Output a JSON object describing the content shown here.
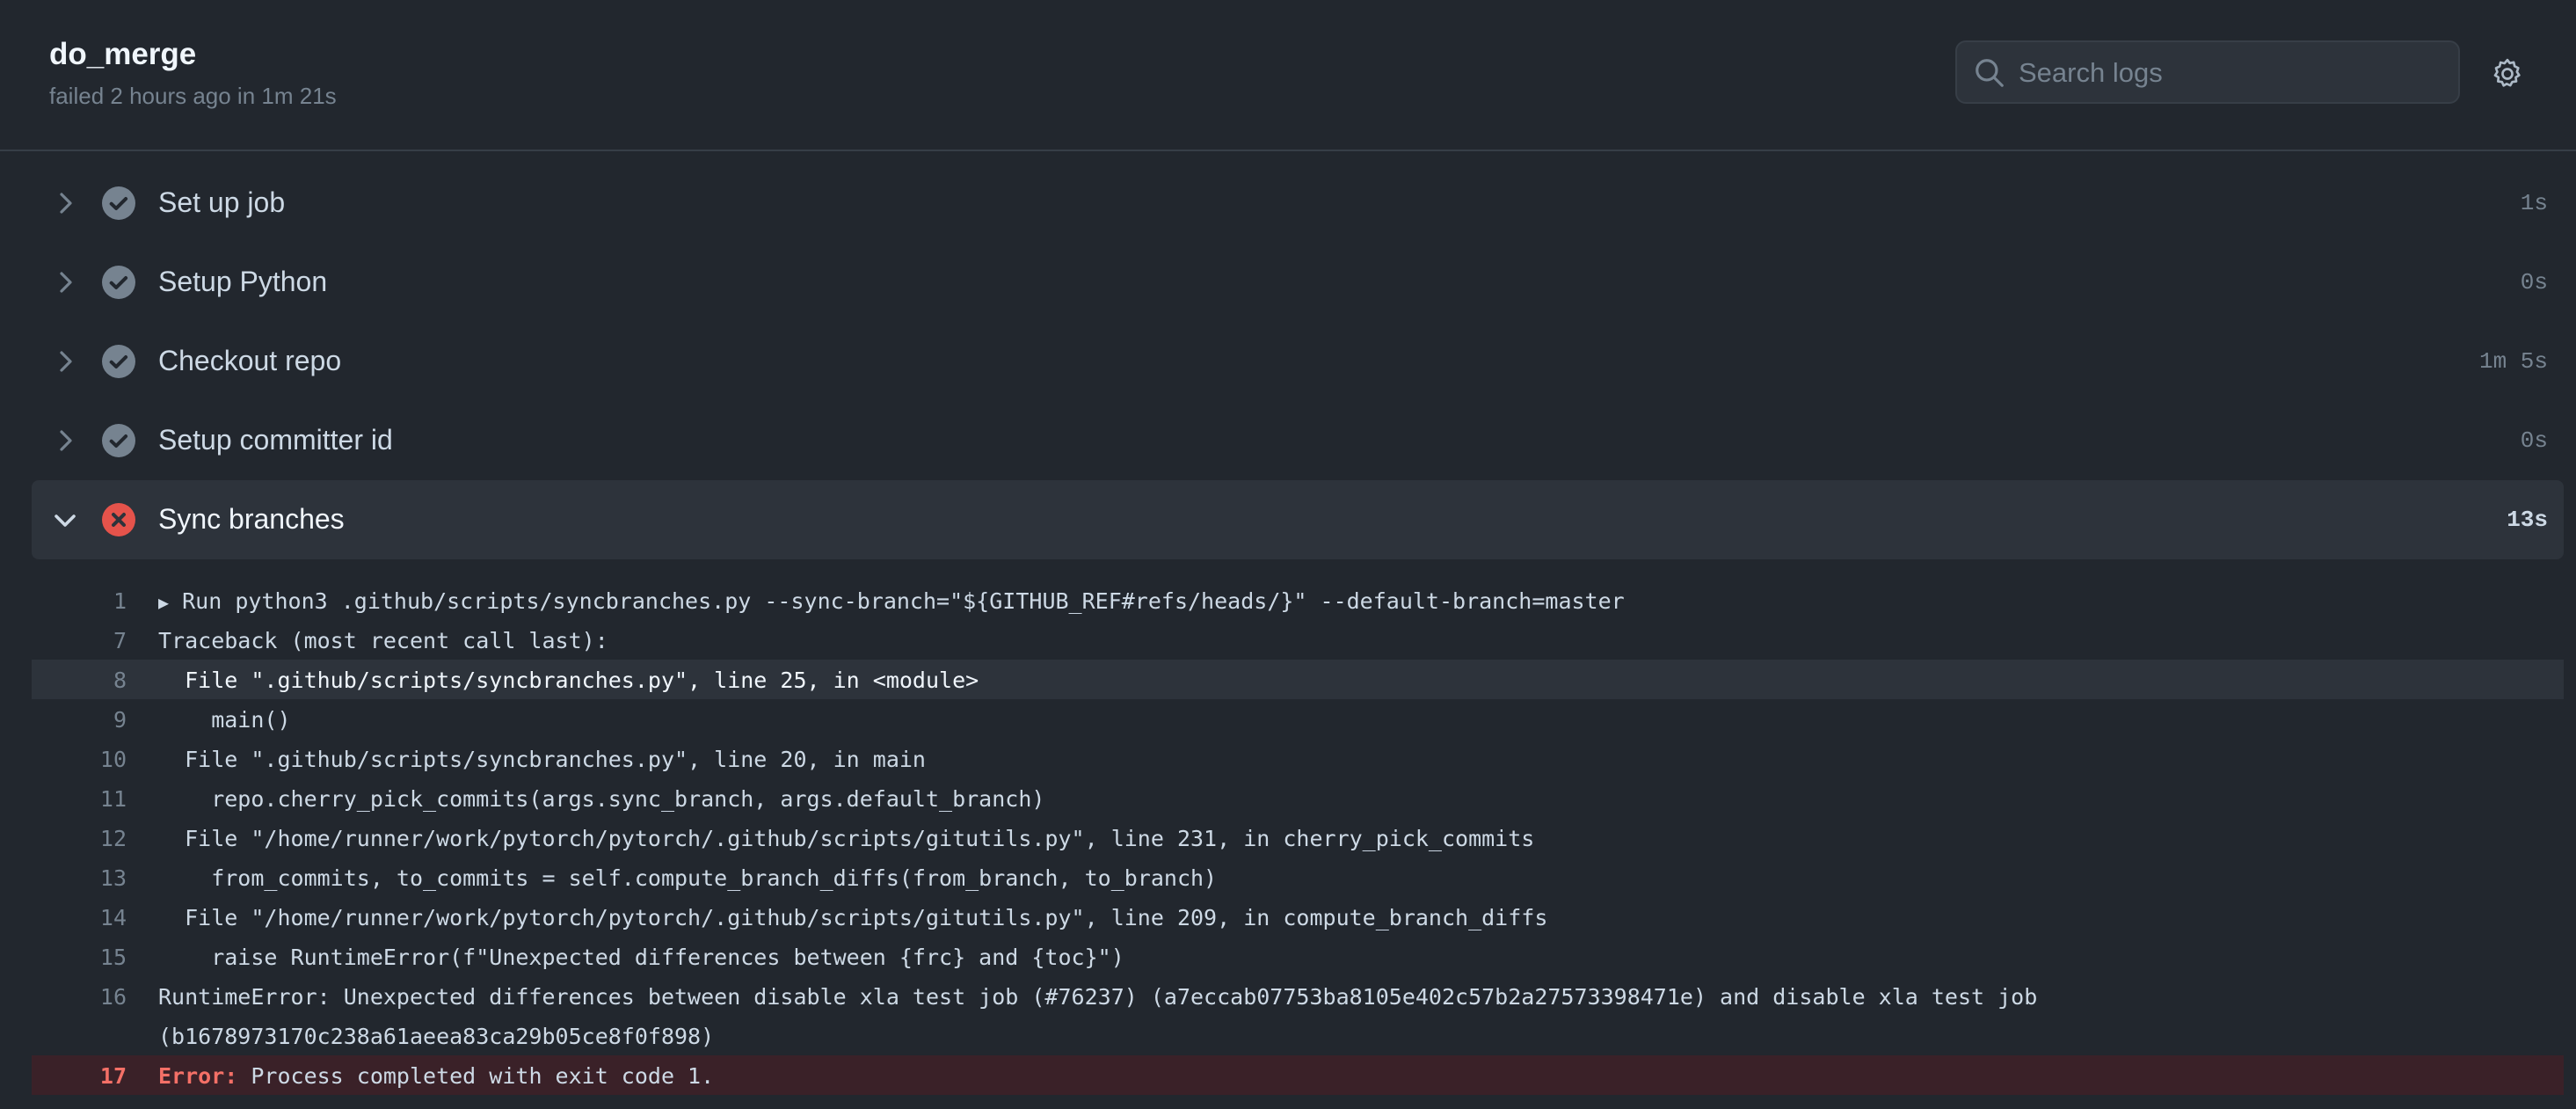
{
  "job": {
    "title": "do_merge",
    "subtitle": "failed 2 hours ago in 1m 21s"
  },
  "search": {
    "placeholder": "Search logs"
  },
  "steps": [
    {
      "name": "Set up job",
      "duration": "1s",
      "status": "success"
    },
    {
      "name": "Setup Python",
      "duration": "0s",
      "status": "success"
    },
    {
      "name": "Checkout repo",
      "duration": "1m 5s",
      "status": "success"
    },
    {
      "name": "Setup committer id",
      "duration": "0s",
      "status": "success"
    },
    {
      "name": "Sync branches",
      "duration": "13s",
      "status": "failure",
      "expanded": true
    }
  ],
  "log": [
    {
      "n": "1",
      "text": "Run python3 .github/scripts/syncbranches.py --sync-branch=\"${GITHUB_REF#refs/heads/}\" --default-branch=master"
    },
    {
      "n": "7",
      "text": "Traceback (most recent call last):"
    },
    {
      "n": "8",
      "text": "  File \".github/scripts/syncbranches.py\", line 25, in <module>"
    },
    {
      "n": "9",
      "text": "    main()"
    },
    {
      "n": "10",
      "text": "  File \".github/scripts/syncbranches.py\", line 20, in main"
    },
    {
      "n": "11",
      "text": "    repo.cherry_pick_commits(args.sync_branch, args.default_branch)"
    },
    {
      "n": "12",
      "text": "  File \"/home/runner/work/pytorch/pytorch/.github/scripts/gitutils.py\", line 231, in cherry_pick_commits"
    },
    {
      "n": "13",
      "text": "    from_commits, to_commits = self.compute_branch_diffs(from_branch, to_branch)"
    },
    {
      "n": "14",
      "text": "  File \"/home/runner/work/pytorch/pytorch/.github/scripts/gitutils.py\", line 209, in compute_branch_diffs"
    },
    {
      "n": "15",
      "text": "    raise RuntimeError(f\"Unexpected differences between {frc} and {toc}\")"
    },
    {
      "n": "16",
      "text": "RuntimeError: Unexpected differences between disable xla test job (#76237) (a7eccab07753ba8105e402c57b2a27573398471e) and disable xla test job",
      "text2": "(b1678973170c238a61aeea83ca29b05ce8f0f898)"
    },
    {
      "n": "17",
      "label": "Error:",
      "text": " Process completed with exit code 1."
    }
  ],
  "colors": {
    "background": "#22272e",
    "success_icon": "#768390",
    "failure_icon": "#e5534b",
    "error_text": "#f47067"
  },
  "icons": {
    "search": "search-icon",
    "settings": "gear-icon",
    "collapsed": "chevron-right-icon",
    "expanded": "chevron-down-icon",
    "success": "check-circle-icon",
    "failure": "x-circle-icon",
    "run_toggle": "triangle-right-icon"
  }
}
